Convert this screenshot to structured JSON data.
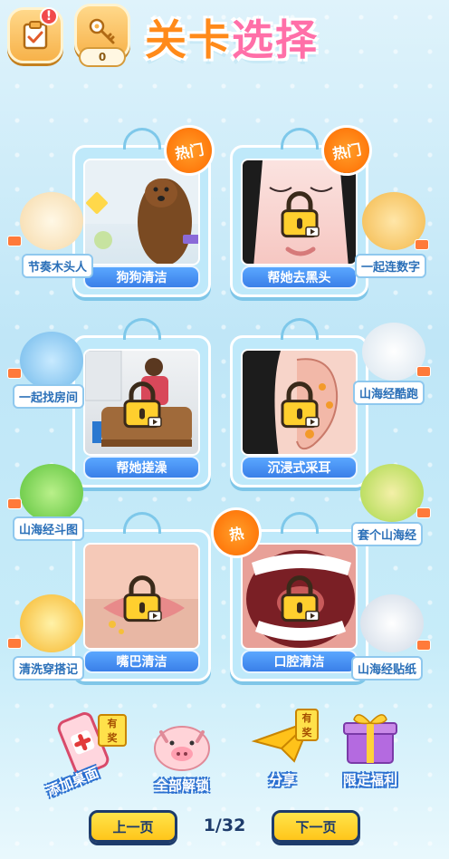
{
  "header": {
    "title_part1": "关卡",
    "title_part2": "选择",
    "key_count": "0",
    "task_badge": "!"
  },
  "levels": [
    {
      "label": "狗狗清洁",
      "hot": "热门",
      "locked": false
    },
    {
      "label": "帮她去黑头",
      "hot": "热门",
      "locked": true
    },
    {
      "label": "帮她搓澡",
      "hot": "",
      "locked": true
    },
    {
      "label": "沉浸式采耳",
      "hot": "",
      "locked": true
    },
    {
      "label": "嘴巴清洁",
      "hot": "",
      "locked": true
    },
    {
      "label": "口腔清洁",
      "hot": "热",
      "locked": true
    }
  ],
  "side_games": [
    "节奏木头人",
    "一起连数字",
    "一起找房间",
    "山海经酷跑",
    "山海经斗图",
    "套个山海经",
    "清洗穿搭记",
    "山海经贴纸"
  ],
  "features": {
    "add_desktop": "添加桌面",
    "unlock_all": "全部解锁",
    "share": "分享",
    "limited_bonus": "限定福利",
    "reward_tag": "有奖"
  },
  "pager": {
    "prev": "上一页",
    "next": "下一页",
    "page": "1/32"
  },
  "colors": {
    "title_orange": "#ff8a1a",
    "title_pink": "#ff6fa8",
    "card_label_blue": "#3a7fe8",
    "hot_orange": "#ff6a00",
    "pager_yellow": "#ffc61a"
  },
  "icons": {
    "task": "clipboard-check-icon",
    "key": "key-icon",
    "lock": "padlock-icon",
    "video": "video-ad-icon",
    "phone_add": "phone-plus-icon",
    "pig": "pig-icon",
    "paper_plane": "paper-plane-icon",
    "gift": "gift-box-icon"
  }
}
